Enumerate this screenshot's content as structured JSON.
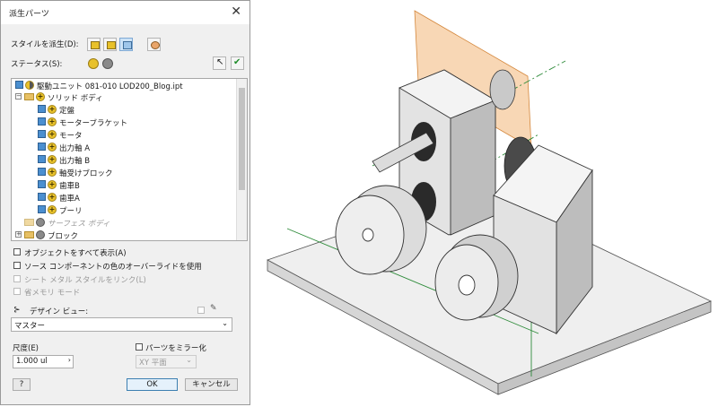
{
  "dialog": {
    "title": "派生パーツ",
    "close_glyph": "✕",
    "style_label": "スタイルを派生(D):",
    "status_label": "ステータス(S):",
    "tree": {
      "root": "駆動ユニット 081-010 LOD200_Blog.ipt",
      "solid_folder": "ソリッド ボディ",
      "bodies": [
        "定盤",
        "モーターブラケット",
        "モータ",
        "出力軸 A",
        "出力軸 B",
        "軸受けブロック",
        "歯車B",
        "歯車A",
        "プーリ"
      ],
      "surface_folder": "サーフェス ボディ",
      "block_folder": "ブロック"
    },
    "options": {
      "show_all": "オブジェクトをすべて表示(A)",
      "override_color": "ソース コンポーネントの色のオーバーライドを使用",
      "sheet_metal": "シート メタル スタイルをリンク(L)",
      "reduced_memory": "省メモリ モード"
    },
    "design_view_label": "デザイン ビュー:",
    "design_view_value": "マスター",
    "scale_label": "尺度(E)",
    "scale_value": "1.000 ul",
    "mirror_label": "パーツをミラー化",
    "mirror_plane": "XY 平面",
    "help_glyph": "?",
    "ok": "OK",
    "cancel": "キャンセル"
  },
  "colors": {
    "plus_icon": "#e8c12a",
    "part_icon": "#4b8fd0",
    "plane_orange": "#f0a65a",
    "axis_green": "#2e8b3a"
  },
  "icons": [
    "close-icon",
    "derive-style-icon",
    "plus-status-icon",
    "exclude-status-icon",
    "select-arrow-icon",
    "checkmark-icon",
    "folder-icon",
    "part-icon",
    "design-view-icon",
    "help-icon"
  ]
}
